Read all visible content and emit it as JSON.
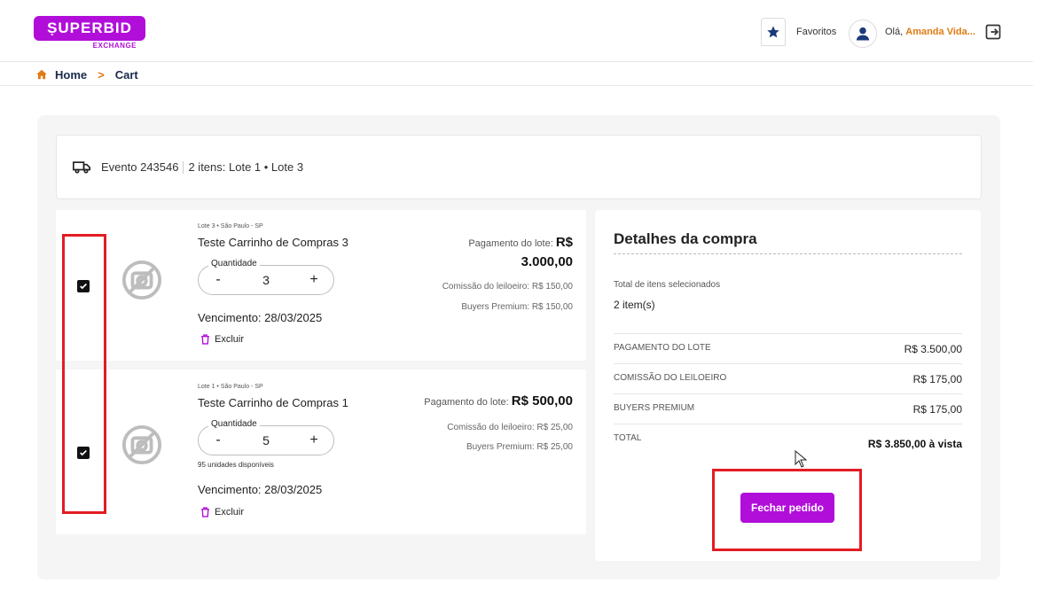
{
  "header": {
    "logo_text": "ṢUPERBID",
    "logo_sub": "EXCHANGE",
    "favorites_label": "Favoritos",
    "greeting_prefix": "Olá,",
    "user_name": "Amanda Vida..."
  },
  "breadcrumb": {
    "home": "Home",
    "separator": ">",
    "current": "Cart"
  },
  "event": {
    "label": "Evento 243546",
    "items_text": "2 itens: Lote 1 • Lote 3"
  },
  "items": [
    {
      "location": "Lote 3 • São Paulo - SP",
      "title": "Teste Carrinho de Compras 3",
      "quantity_label": "Quantidade",
      "quantity": "3",
      "minus": "-",
      "plus": "+",
      "due": "Vencimento: 28/03/2025",
      "delete": "Excluir",
      "payment_label": "Pagamento do lote:",
      "payment_currency": "R$",
      "payment_value": "3.000,00",
      "commission": "Comissão do leiloeiro: R$ 150,00",
      "buyers_premium": "Buyers Premium: R$ 150,00",
      "checked": true
    },
    {
      "location": "Lote 1 • São Paulo - SP",
      "title": "Teste Carrinho de Compras 1",
      "quantity_label": "Quantidade",
      "quantity": "5",
      "minus": "-",
      "plus": "+",
      "available": "95 unidades disponíveis",
      "due": "Vencimento: 28/03/2025",
      "delete": "Excluir",
      "payment_label": "Pagamento do lote:",
      "payment_value": "R$ 500,00",
      "commission": "Comissão do leiloeiro: R$ 25,00",
      "buyers_premium": "Buyers Premium: R$ 25,00",
      "checked": true
    }
  ],
  "summary": {
    "title": "Detalhes da compra",
    "total_items_label": "Total de itens selecionados",
    "total_items_value": "2 item(s)",
    "rows": [
      {
        "label": "PAGAMENTO DO LOTE",
        "value": "R$ 3.500,00"
      },
      {
        "label": "COMISSÃO DO LEILOEIRO",
        "value": "R$ 175,00"
      },
      {
        "label": "BUYERS PREMIUM",
        "value": "R$ 175,00"
      },
      {
        "label": "TOTAL",
        "value": "R$ 3.850,00 à vista"
      }
    ],
    "button": "Fechar pedido"
  },
  "colors": {
    "brand": "#b10fd9",
    "accent": "#e07b14",
    "highlight": "#e31c23"
  },
  "icons": {
    "home": "home-icon",
    "favorites": "star-icon",
    "user": "user-icon",
    "logout": "logout-icon",
    "truck": "truck-icon",
    "photo": "no-photo-icon",
    "trash": "trash-icon",
    "check": "check-icon"
  }
}
